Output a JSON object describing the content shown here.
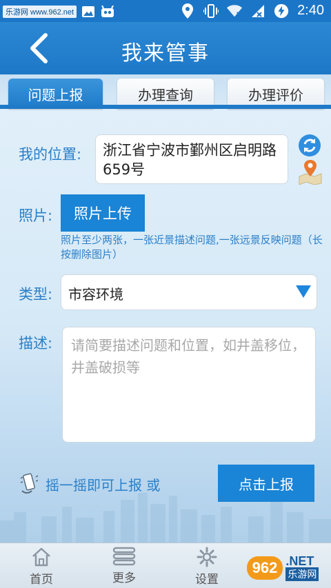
{
  "status_bar": {
    "watermark": "乐游网 www.962.net",
    "time": "2:40"
  },
  "header": {
    "title": "我来管事"
  },
  "tabs": [
    {
      "label": "问题上报",
      "active": true
    },
    {
      "label": "办理查询",
      "active": false
    },
    {
      "label": "办理评价",
      "active": false
    }
  ],
  "form": {
    "location_label": "我的位置:",
    "location_value": "浙江省宁波市鄞州区启明路659号",
    "photo_label": "照片:",
    "photo_button": "照片上传",
    "photo_hint": "照片至少两张，一张近景描述问题,一张远景反映问题（长按删除图片）",
    "type_label": "类型:",
    "type_value": "市容环境",
    "desc_label": "描述:",
    "desc_placeholder": "请简要描述问题和位置，如井盖移位，井盖破损等"
  },
  "actions": {
    "shake_text": "摇一摇即可上报 或",
    "submit_button": "点击上报"
  },
  "bottom_nav": [
    {
      "label": "首页",
      "icon": "home-icon"
    },
    {
      "label": "更多",
      "icon": "menu-icon"
    },
    {
      "label": "设置",
      "icon": "gear-icon"
    }
  ],
  "watermark": {
    "badge": "962",
    "net": ".NET",
    "cn": "乐游网"
  },
  "colors": {
    "primary": "#1e78c8",
    "accent_text": "#2a7fc8",
    "button": "#1a84d6"
  }
}
